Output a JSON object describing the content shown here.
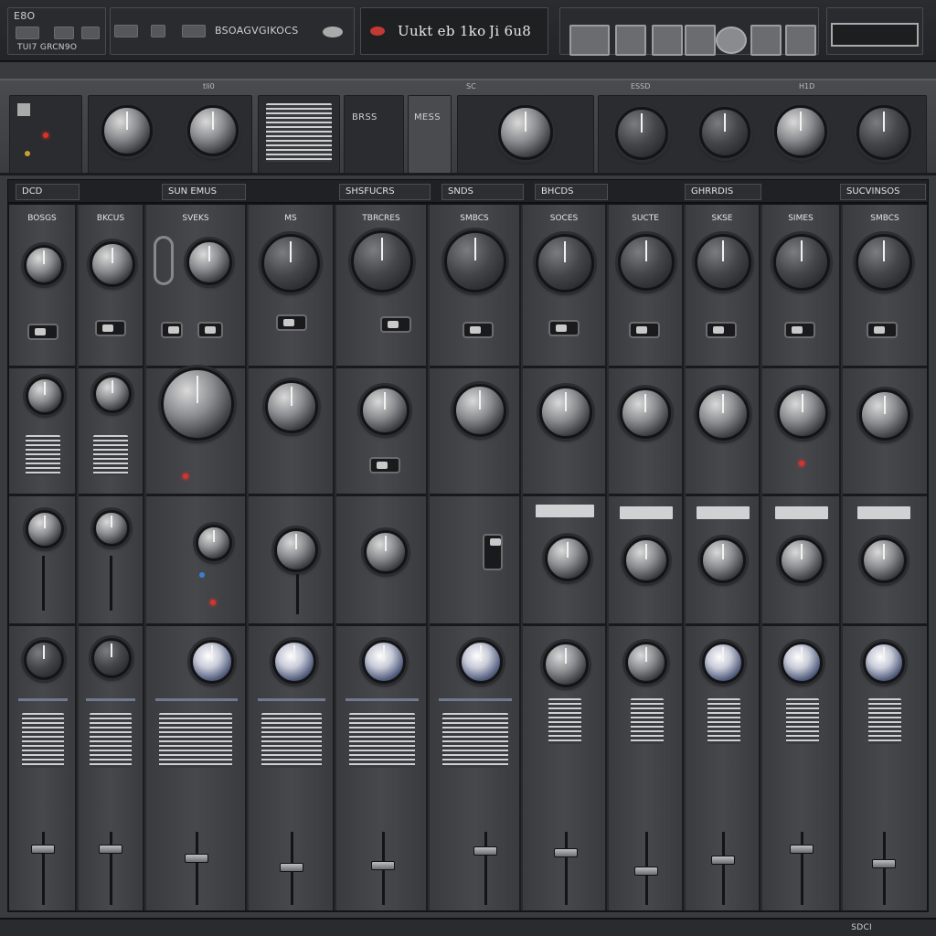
{
  "menubar": {
    "file_label": "E8O",
    "left_sub_label": "TUI7 GRCN9O",
    "mid_label": "BSOAGVGIKOCS",
    "title": "Uukt eb 1ko",
    "counter": "Ji 6u8"
  },
  "strip": {
    "section_labels": [
      "tli0",
      "SC",
      "ESSD",
      "H1D"
    ],
    "panel_a_text": "MESS",
    "panel_b_text": "BRSS"
  },
  "channel_headers": [
    "DCD",
    "SUN EMUS",
    "SHSFUCRS",
    "SNDS",
    "BHCDS",
    "GHRRDIS",
    "SUCVINSOS"
  ],
  "columns": [
    {
      "name": "BOSGS"
    },
    {
      "name": "BKCUS"
    },
    {
      "name": "SVEKS"
    },
    {
      "name": "MS"
    },
    {
      "name": "TBRCRES"
    },
    {
      "name": "SMBCS"
    },
    {
      "name": "SOCES"
    },
    {
      "name": "SUCTE"
    },
    {
      "name": "SKSE"
    },
    {
      "name": "SIMES"
    },
    {
      "name": "SMBCS"
    }
  ],
  "footer": {
    "label": "SDCI"
  }
}
